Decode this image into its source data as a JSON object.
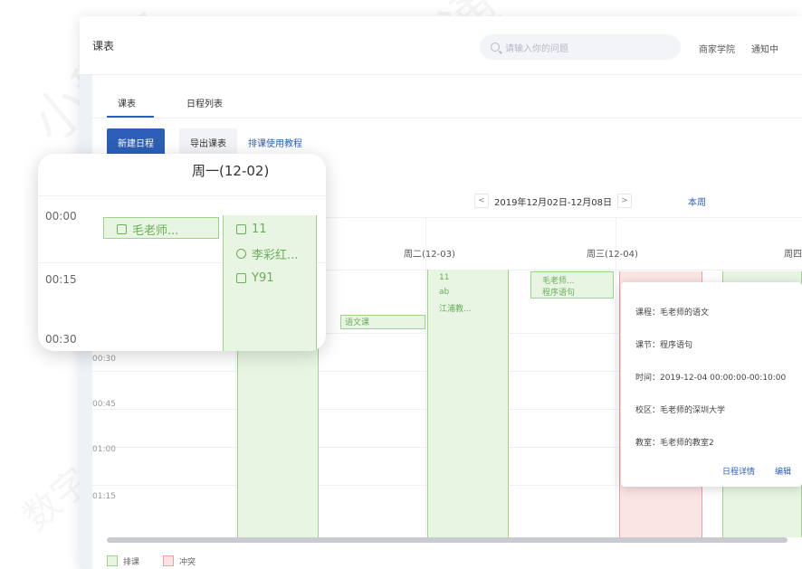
{
  "header": {
    "title": "课表",
    "search_placeholder": "请输入你的问题",
    "links": [
      "商家学院",
      "通知中"
    ]
  },
  "tabs": [
    {
      "label": "课表",
      "active": true
    },
    {
      "label": "日程列表",
      "active": false
    }
  ],
  "toolbar": {
    "new_schedule": "新建日程",
    "export": "导出课表",
    "help_link": "排课使用教程"
  },
  "week_nav": {
    "prev": "<",
    "range": "2019年12月02日-12月08日",
    "next": ">",
    "this_week": "本周"
  },
  "days": [
    "周一(12-02)",
    "周二(12-03)",
    "周三(12-04)",
    "周四"
  ],
  "times": [
    "00:00",
    "00:15",
    "00:30",
    "00:45",
    "01:00",
    "01:15"
  ],
  "events": {
    "mon_teacher": "毛老师...",
    "mon_course": "11",
    "mon_teacher2": "李彩红...",
    "mon_room": "Y91",
    "tue_course": "11",
    "tue_teacher": "ab",
    "tue_room": "江浦教...",
    "tue_lang": "语文课",
    "wed_teacher": "毛老师...",
    "wed_lesson": "程序语句"
  },
  "popover": {
    "course": "课程：毛老师的语文",
    "lesson": "课节：程序语句",
    "time": "时间：2019-12-04 00:00:00-00:10:00",
    "campus": "校区：毛老师的深圳大学",
    "classroom": "教室：毛老师的教室2",
    "detail_link": "日程详情",
    "edit_link": "编辑"
  },
  "legend": [
    {
      "label": "排课",
      "color": "#9cd48a"
    },
    {
      "label": "冲突",
      "color": "#f0a0a0"
    }
  ],
  "zoom": {
    "day": "周一(12-02)",
    "times": [
      "00:00",
      "00:15",
      "00:30"
    ],
    "teacher": "毛老师...",
    "course": "11",
    "teacher2": "李彩红...",
    "room": "Y91"
  },
  "watermarks": [
    "小鹅通",
    "数字"
  ],
  "colors": {
    "primary": "#2d5fb8",
    "event_green": "#e8f5e3",
    "event_border": "#9cd48a",
    "conflict": "#fbe4e4"
  }
}
